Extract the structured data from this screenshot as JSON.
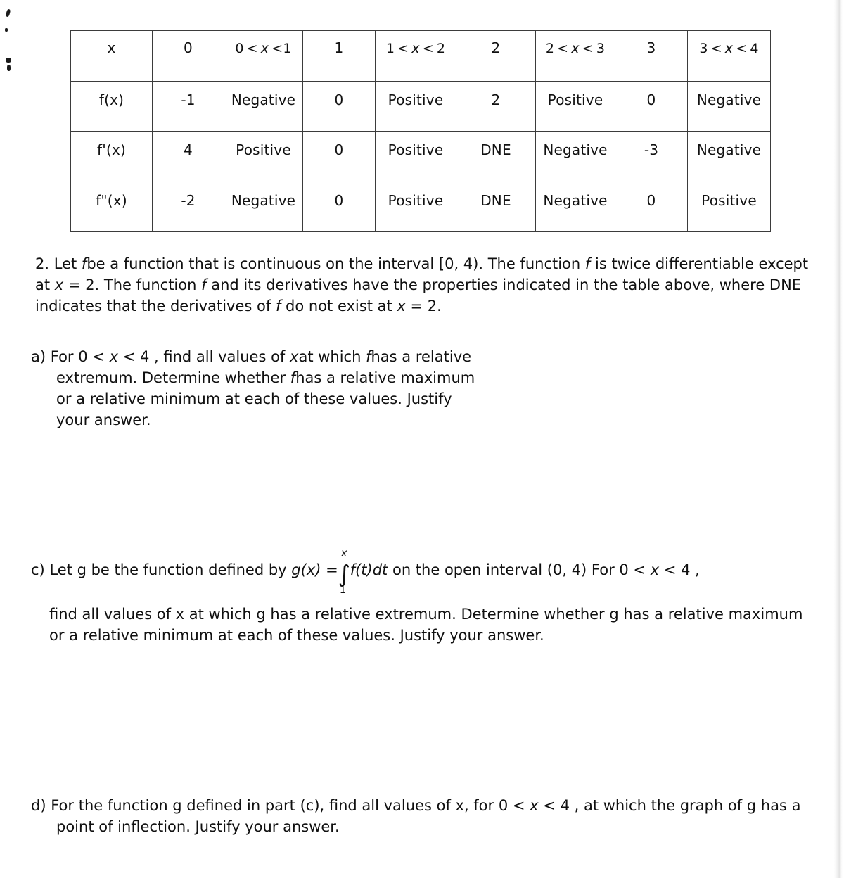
{
  "document": {
    "type": "calculus-worksheet-scan"
  },
  "table": {
    "columns": [
      "x",
      "0",
      "0 < x < 1",
      "1",
      "1 < x < 2",
      "2",
      "2 < x < 3",
      "3",
      "3 < x < 4"
    ],
    "col_headers_plain": {
      "c0": "x",
      "c1": "0",
      "c2_left": "0",
      "c2_mid": "x",
      "c2_right": "1",
      "c3": "1",
      "c4_left": "1",
      "c4_mid": "x",
      "c4_right": "2",
      "c5": "2",
      "c6_left": "2",
      "c6_mid": "x",
      "c6_right": "3",
      "c7": "3",
      "c8_left": "3",
      "c8_mid": "x",
      "c8_right": "4"
    },
    "rows": [
      {
        "label": "f(x)",
        "cells": [
          "-1",
          "Negative",
          "0",
          "Positive",
          "2",
          "Positive",
          "0",
          "Negative"
        ]
      },
      {
        "label": "f'(x)",
        "cells": [
          "4",
          "Positive",
          "0",
          "Positive",
          "DNE",
          "Negative",
          "-3",
          "Negative"
        ]
      },
      {
        "label": "f\"(x)",
        "cells": [
          "-2",
          "Negative",
          "0",
          "Positive",
          "DNE",
          "Negative",
          "0",
          "Positive"
        ]
      }
    ]
  },
  "problem": {
    "number": "2.",
    "statement_part1": "Let",
    "statement_f1": "f",
    "statement_part2": "be a function that is continuous on the interval [0, 4). The function",
    "statement_f2": "f",
    "statement_part3": "is twice differentiable except at",
    "statement_x1": "x",
    "statement_part4": "= 2. The function",
    "statement_f3": "f",
    "statement_part5": "and its derivatives have the properties indicated in the table above, where DNE indicates that the derivatives of",
    "statement_f4": "f",
    "statement_part6": "do not exist at",
    "statement_x2": "x",
    "statement_part7": "= 2."
  },
  "parts": {
    "a": {
      "marker": "a)",
      "text_1": "For 0 <",
      "var_x1": "x",
      "text_2": "< 4 , find all values of",
      "var_x2": "x",
      "text_3": "at which",
      "var_f": "f",
      "text_4": "has a relative extremum. Determine whether",
      "var_f2": "f",
      "text_5": "has a relative maximum or a relative minimum at each of these values. Justify your answer."
    },
    "c": {
      "marker": "c)",
      "text_1": "Let g be the function defined by",
      "formula_lhs": "g(x) =",
      "integral_lower": "1",
      "integral_upper": "x",
      "integral_sign": "∫",
      "integrand": "f(t)dt",
      "text_2": "on the open interval (0, 4) For 0 <",
      "var_x": "x",
      "text_3": "< 4 ,",
      "text_rest": "find all values of x at which g has a relative extremum. Determine whether g has a relative maximum or a relative minimum at each of these values. Justify your answer."
    },
    "d": {
      "marker": "d)",
      "text_1": "For the function g defined in part (c), find all values of x, for 0 <",
      "var_x": "x",
      "text_2": "< 4 , at which the graph of g has a point of inflection. Justify your answer."
    }
  },
  "colors": {
    "ink": "#101010",
    "rule": "#3b3b3b",
    "paper": "#ffffff"
  }
}
